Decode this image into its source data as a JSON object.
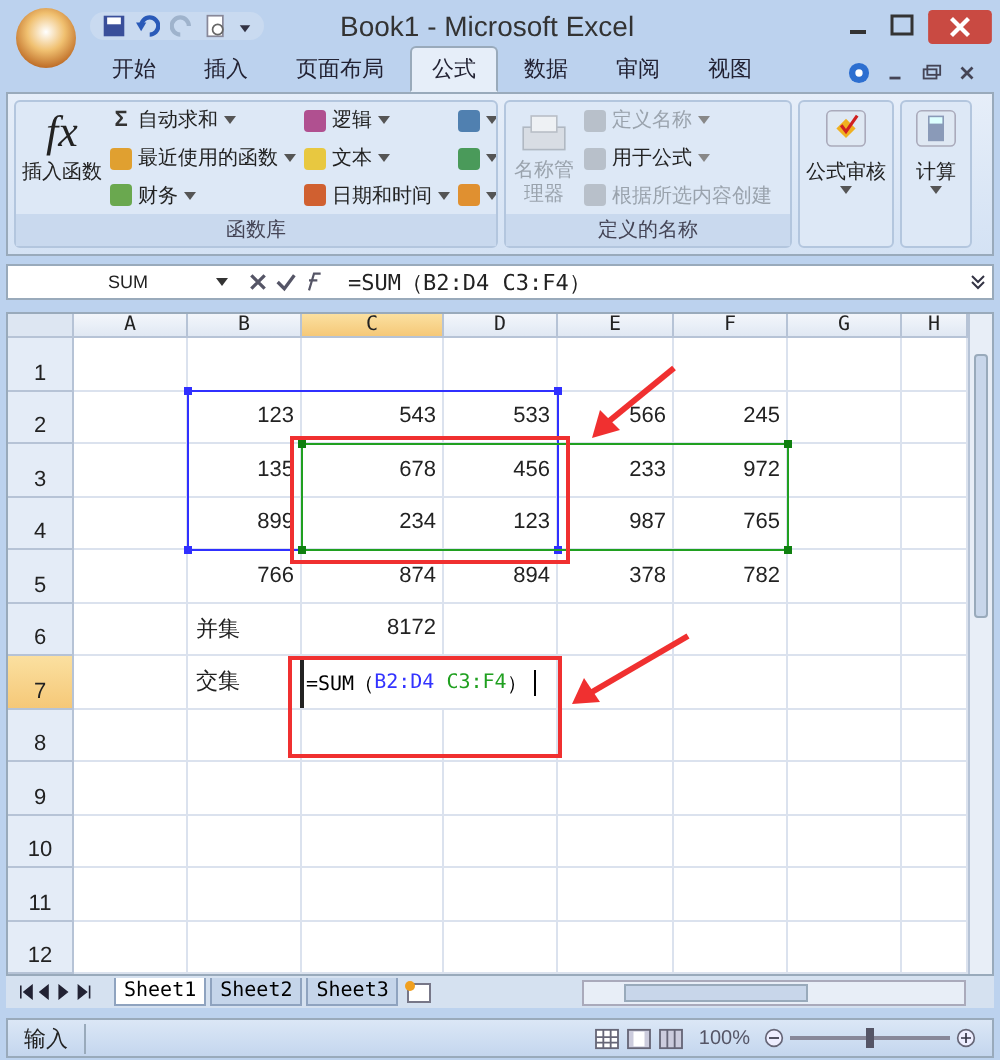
{
  "window": {
    "title": "Book1 - Microsoft Excel"
  },
  "tabs": [
    {
      "label": "开始",
      "selected": false
    },
    {
      "label": "插入",
      "selected": false
    },
    {
      "label": "页面布局",
      "selected": false
    },
    {
      "label": "公式",
      "selected": true
    },
    {
      "label": "数据",
      "selected": false
    },
    {
      "label": "审阅",
      "selected": false
    },
    {
      "label": "视图",
      "selected": false
    }
  ],
  "ribbon": {
    "function_library": {
      "label": "函数库",
      "insert_function": {
        "icon_text": "fx",
        "label": "插入函数"
      },
      "column_1": [
        {
          "icon_text": "Σ",
          "label": "自动求和",
          "color": "#333333"
        },
        {
          "label": "最近使用的函数",
          "color": "#e0a030"
        },
        {
          "label": "财务",
          "color": "#6aa84f"
        }
      ],
      "column_2": [
        {
          "label": "逻辑",
          "color": "#b05090"
        },
        {
          "label": "文本",
          "color": "#e8c840"
        },
        {
          "label": "日期和时间",
          "color": "#d06030"
        }
      ],
      "column_3": [
        {
          "color": "#5080b0"
        },
        {
          "color": "#4a9a5a"
        },
        {
          "color": "#e09030"
        }
      ]
    },
    "defined_names": {
      "label": "定义的名称",
      "name_manager": {
        "label": "名称管理器",
        "disabled": true
      },
      "items": [
        {
          "label": "定义名称",
          "disabled": true,
          "dropdown": true
        },
        {
          "label": "用于公式",
          "disabled": false,
          "dropdown": true
        },
        {
          "label": "根据所选内容创建",
          "disabled": true,
          "dropdown": false
        }
      ]
    },
    "formula_auditing": {
      "label": "公式审核"
    },
    "calculation": {
      "label": "计算"
    }
  },
  "formula_bar": {
    "name_box": "SUM",
    "formula": "=SUM（B2:D4 C3:F4）"
  },
  "columns": [
    {
      "label": "A",
      "selected": false
    },
    {
      "label": "B",
      "selected": false
    },
    {
      "label": "C",
      "selected": true
    },
    {
      "label": "D",
      "selected": false
    },
    {
      "label": "E",
      "selected": false
    },
    {
      "label": "F",
      "selected": false
    },
    {
      "label": "G",
      "selected": false
    },
    {
      "label": "H",
      "selected": false
    }
  ],
  "rows": [
    {
      "label": "1",
      "selected": false,
      "cells": [
        null,
        null,
        null,
        null,
        null,
        null,
        null,
        null
      ]
    },
    {
      "label": "2",
      "selected": false,
      "cells": [
        null,
        {
          "kind": "number",
          "text": "123"
        },
        {
          "kind": "number",
          "text": "543"
        },
        {
          "kind": "number",
          "text": "533"
        },
        {
          "kind": "number",
          "text": "566"
        },
        {
          "kind": "number",
          "text": "245"
        },
        null,
        null
      ]
    },
    {
      "label": "3",
      "selected": false,
      "cells": [
        null,
        {
          "kind": "number",
          "text": "135"
        },
        {
          "kind": "number",
          "text": "678"
        },
        {
          "kind": "number",
          "text": "456"
        },
        {
          "kind": "number",
          "text": "233"
        },
        {
          "kind": "number",
          "text": "972"
        },
        null,
        null
      ]
    },
    {
      "label": "4",
      "selected": false,
      "cells": [
        null,
        {
          "kind": "number",
          "text": "899"
        },
        {
          "kind": "number",
          "text": "234"
        },
        {
          "kind": "number",
          "text": "123"
        },
        {
          "kind": "number",
          "text": "987"
        },
        {
          "kind": "number",
          "text": "765"
        },
        null,
        null
      ]
    },
    {
      "label": "5",
      "selected": false,
      "cells": [
        null,
        {
          "kind": "number",
          "text": "766"
        },
        {
          "kind": "number",
          "text": "874"
        },
        {
          "kind": "number",
          "text": "894"
        },
        {
          "kind": "number",
          "text": "378"
        },
        {
          "kind": "number",
          "text": "782"
        },
        null,
        null
      ]
    },
    {
      "label": "6",
      "selected": false,
      "cells": [
        null,
        {
          "kind": "label",
          "text": "并集"
        },
        {
          "kind": "number",
          "text": "8172"
        },
        null,
        null,
        null,
        null,
        null
      ]
    },
    {
      "label": "7",
      "selected": true,
      "cells": [
        null,
        {
          "kind": "label",
          "text": "交集"
        },
        {
          "kind": "editing",
          "parts": [
            {
              "text": "=SUM（",
              "color": "#000000"
            },
            {
              "text": "B2:D4 ",
              "color": "#3333ff"
            },
            {
              "text": "C3:F4",
              "color": "#20a020"
            },
            {
              "text": "）",
              "color": "#000000"
            }
          ]
        },
        null,
        null,
        null,
        null,
        null
      ]
    },
    {
      "label": "8",
      "selected": false,
      "cells": [
        null,
        null,
        null,
        null,
        null,
        null,
        null,
        null
      ]
    },
    {
      "label": "9",
      "selected": false,
      "cells": [
        null,
        null,
        null,
        null,
        null,
        null,
        null,
        null
      ]
    },
    {
      "label": "10",
      "selected": false,
      "cells": [
        null,
        null,
        null,
        null,
        null,
        null,
        null,
        null
      ]
    },
    {
      "label": "11",
      "selected": false,
      "cells": [
        null,
        null,
        null,
        null,
        null,
        null,
        null,
        null
      ]
    },
    {
      "label": "12",
      "selected": false,
      "cells": [
        null,
        null,
        null,
        null,
        null,
        null,
        null,
        null
      ]
    }
  ],
  "sheet_tabs": [
    {
      "label": "Sheet1",
      "selected": true
    },
    {
      "label": "Sheet2",
      "selected": false
    },
    {
      "label": "Sheet3",
      "selected": false
    }
  ],
  "status_bar": {
    "mode": "输入",
    "zoom": "100%",
    "zoom_slider": {
      "level": 0.5
    }
  }
}
